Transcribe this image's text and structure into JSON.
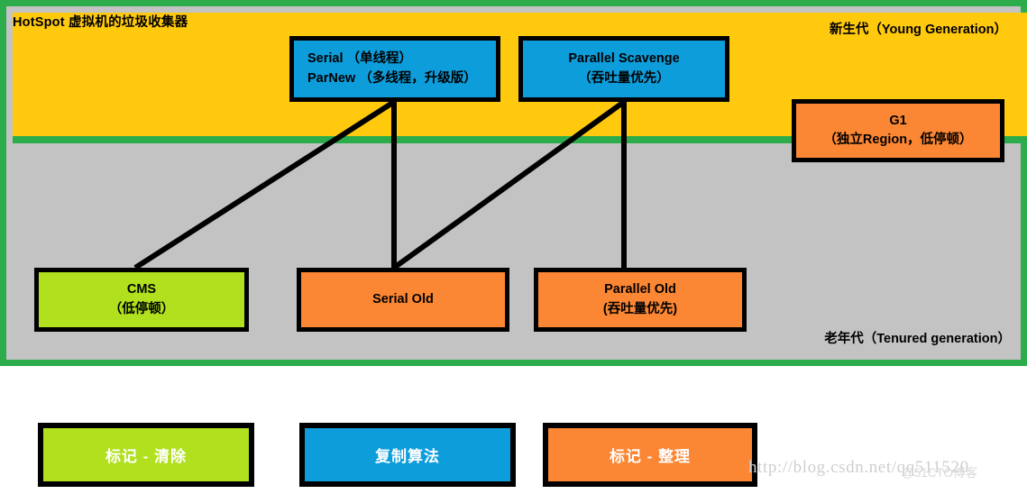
{
  "diagram": {
    "title": "HotSpot 虚拟机的垃圾收集器",
    "young_generation_label": "新生代（Young Generation）",
    "old_generation_label": "老年代（Tenured generation）",
    "colors": {
      "young_band": "#ffc90e",
      "old_band": "#c3c3c3",
      "frame_border": "#2cac4b",
      "blue": "#0d9ddb",
      "orange": "#fb8633",
      "lime": "#b0e01e",
      "line": "#000000"
    }
  },
  "collectors": {
    "serial_parnew": {
      "line1": "Serial （单线程）",
      "line2": "ParNew （多线程，升级版）"
    },
    "parallel_scavenge": {
      "line1": "Parallel Scavenge",
      "line2": "（吞吐量优先）"
    },
    "g1": {
      "line1": "G1",
      "line2": "（独立Region，低停顿）"
    },
    "cms": {
      "line1": "CMS",
      "line2": "（低停顿）"
    },
    "serial_old": {
      "line1": "Serial Old",
      "line2": ""
    },
    "parallel_old": {
      "line1": "Parallel Old",
      "line2": "(吞吐量优先)"
    }
  },
  "legend": [
    {
      "label": "标记 - 清除",
      "color": "#b0e01e"
    },
    {
      "label": "复制算法",
      "color": "#0d9ddb"
    },
    {
      "label": "标记 - 整理",
      "color": "#fb8633"
    }
  ],
  "watermark": {
    "url": "http://blog.csdn.net/qq511520",
    "site": "@51CTO博客"
  }
}
